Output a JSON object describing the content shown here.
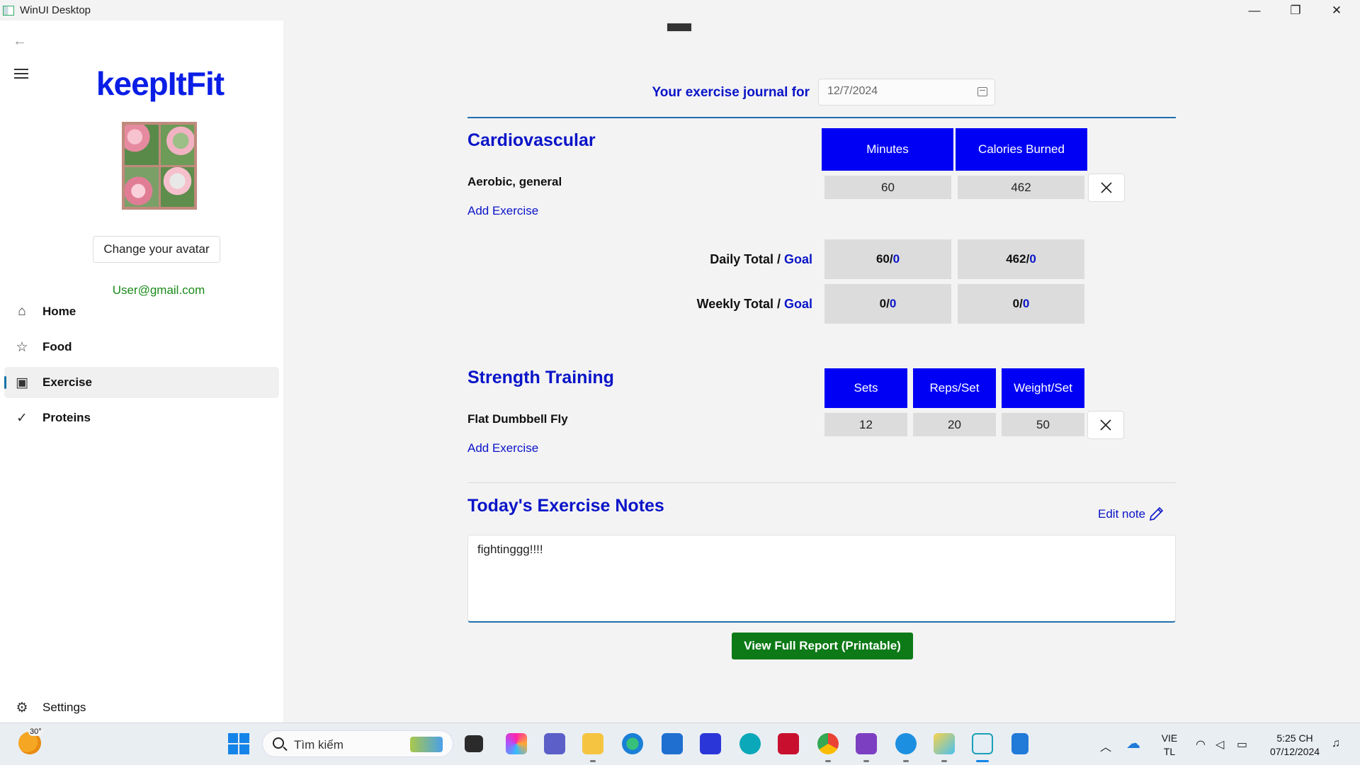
{
  "window": {
    "title": "WinUI Desktop",
    "controls": {
      "minimize": "—",
      "maximize": "❐",
      "close": "✕"
    }
  },
  "sidebar": {
    "back_icon": "back-arrow-icon",
    "menu_icon": "hamburger-menu-icon",
    "logo": "keepItFit",
    "avatar_button": "Change your avatar",
    "email": "User@gmail.com",
    "items": [
      {
        "label": "Home",
        "icon": "home-icon",
        "glyph": "⌂",
        "active": false
      },
      {
        "label": "Food",
        "icon": "star-icon",
        "glyph": "☆",
        "active": false
      },
      {
        "label": "Exercise",
        "icon": "exercise-icon",
        "glyph": "▣",
        "active": true
      },
      {
        "label": "Proteins",
        "icon": "checkmark-icon",
        "glyph": "✓",
        "active": false
      }
    ],
    "settings": {
      "label": "Settings",
      "glyph": "⚙"
    }
  },
  "journal": {
    "label": "Your exercise journal for",
    "date": "12/7/2024"
  },
  "cardio": {
    "title": "Cardiovascular",
    "headers": [
      "Minutes",
      "Calories Burned"
    ],
    "exercises": [
      {
        "name": "Aerobic, general",
        "minutes": "60",
        "calories": "462"
      }
    ],
    "add_label": "Add Exercise",
    "daily": {
      "label": "Daily Total",
      "goal_label": "Goal",
      "minutes": "60",
      "minutes_goal": "0",
      "calories": "462",
      "calories_goal": "0"
    },
    "weekly": {
      "label": "Weekly Total",
      "goal_label": "Goal",
      "minutes": "0",
      "minutes_goal": "0",
      "calories": "0",
      "calories_goal": "0"
    }
  },
  "strength": {
    "title": "Strength Training",
    "headers": [
      "Sets",
      "Reps/Set",
      "Weight/Set"
    ],
    "exercises": [
      {
        "name": "Flat Dumbbell Fly",
        "sets": "12",
        "reps": "20",
        "weight": "50"
      }
    ],
    "add_label": "Add Exercise"
  },
  "notes": {
    "title": "Today's Exercise Notes",
    "edit_label": "Edit note",
    "text": "fightinggg!!!!"
  },
  "report_button": "View Full Report (Printable)",
  "taskbar": {
    "weather_temp": "30°",
    "search_placeholder": "Tìm kiếm",
    "language": "VIE",
    "language_sub": "TL",
    "time": "5:25 CH",
    "date": "07/12/2024"
  },
  "colors": {
    "accent_blue": "#0a14c8",
    "header_blue": "#0000f5",
    "email_green": "#1a8a1a",
    "report_green": "#0d7a17"
  }
}
